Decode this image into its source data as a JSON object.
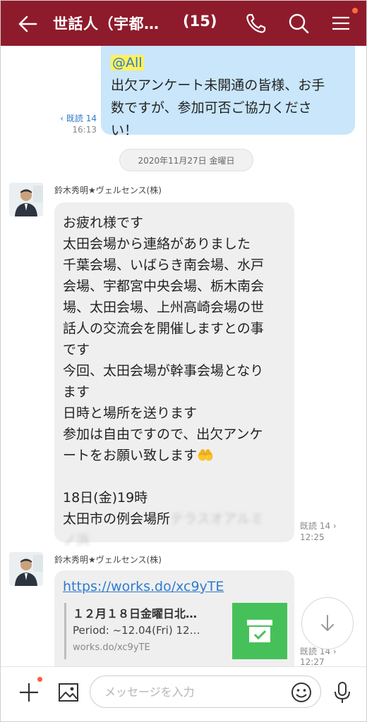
{
  "header": {
    "title": "世話人（宇都…",
    "member_count": "(15)"
  },
  "messages": {
    "outgoing": {
      "mention": "@All",
      "lines": [
        "出欠アンケート未開通の皆様、お手",
        "数ですが、参加可否ご協力くださ",
        "い！"
      ],
      "read": "‹ 既読 14",
      "time": "16:13"
    },
    "date_separator": "2020年11月27日 金曜日",
    "incoming1": {
      "sender": "鈴木秀明★ヴェルセンス(株)",
      "lines": [
        "お疲れ様です",
        "太田会場から連絡がありました",
        "千葉会場、いばらき南会場、水戸",
        "会場、宇都宮中央会場、栃木南会",
        "場、太田会場、上州高崎会場の世",
        "話人の交流会を開催しますとの事",
        "です",
        "今回、太田会場が幹事会場となり",
        "ます",
        "日時と場所を送ります",
        "参加は自由ですので、出欠アンケ",
        "ートをお願い致します🤲",
        "",
        "18日(金)19時",
        "太田市の例会場所"
      ],
      "blurred": [
        "テラスオアルミ",
        "ノ浜"
      ],
      "read": "既読 14 ›",
      "time": "12:25"
    },
    "incoming2": {
      "sender": "鈴木秀明★ヴェルセンス(株)",
      "link": "https://works.do/xc9yTE",
      "preview_title": "１２月１８日金曜日北…",
      "preview_desc": "Period: ~12.04(Fri) 12…",
      "preview_url": "works.do/xc9yTE",
      "read": "既読 14 ›",
      "time": "12:27"
    }
  },
  "composer": {
    "placeholder": "メッセージを入力"
  },
  "icons": [
    "back-arrow-icon",
    "phone-icon",
    "search-icon",
    "menu-icon",
    "plus-icon",
    "image-icon",
    "emoji-icon",
    "microphone-icon",
    "scroll-down-icon",
    "box-check-icon"
  ],
  "colors": {
    "header": "#8e1b2b",
    "bubble_out": "#c9e6fb",
    "bubble_in": "#efefef",
    "link": "#2e7bcf",
    "accent_dot": "#ff6a3d"
  }
}
